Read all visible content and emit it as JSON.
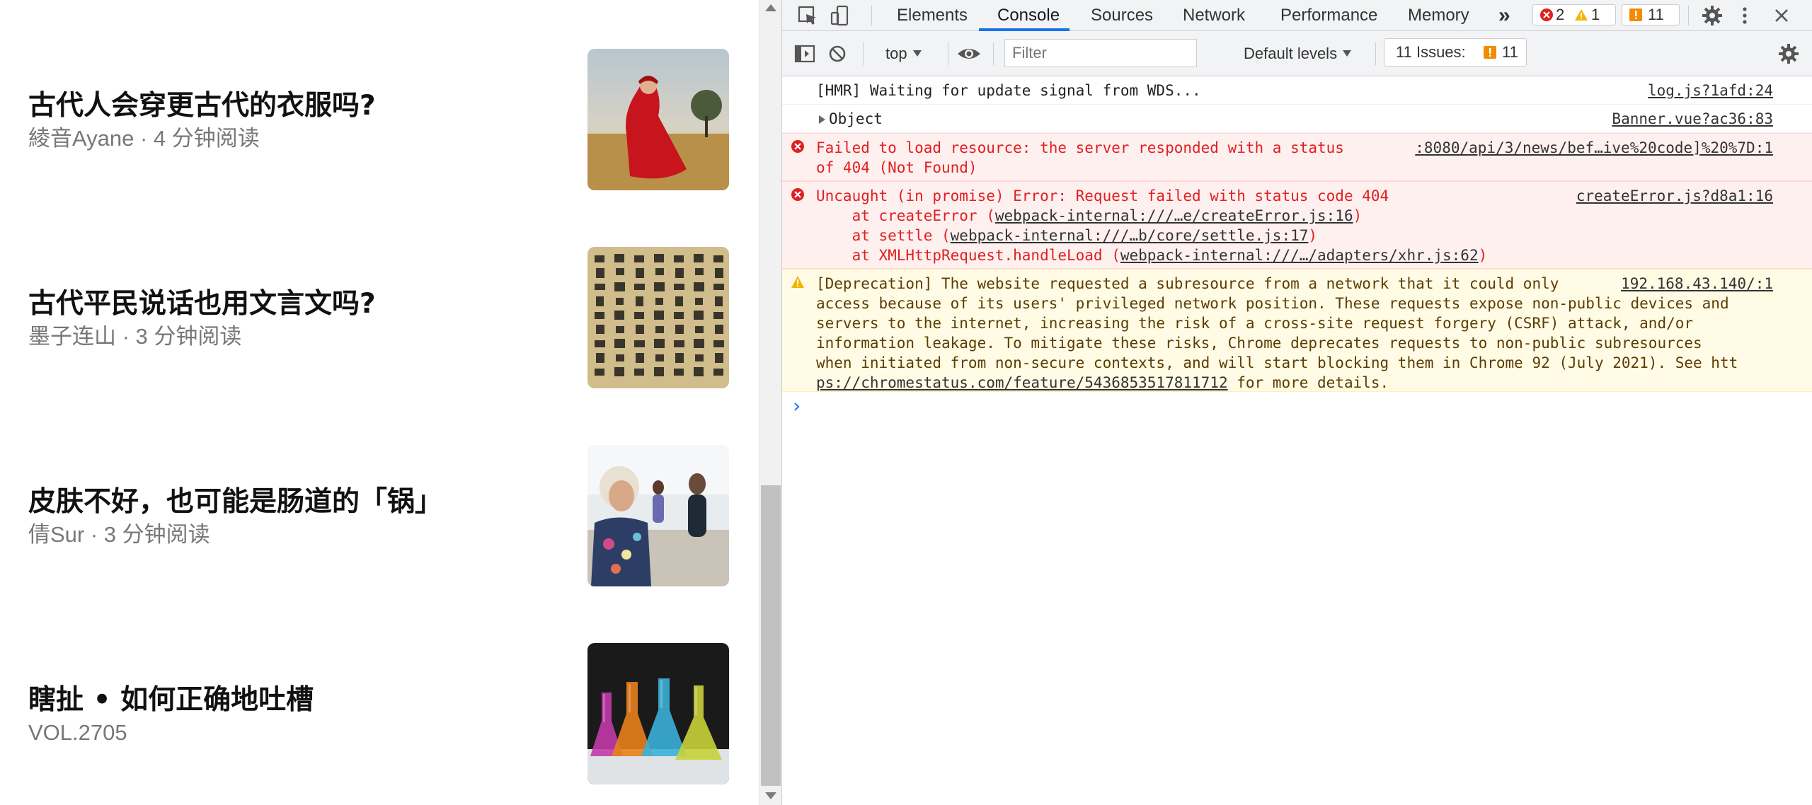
{
  "articles": [
    {
      "title": "古代人会穿更古代的衣服吗?",
      "meta": "綾音Ayane · 4 分钟阅读",
      "thumb": "woman-in-red-dress-photo"
    },
    {
      "title": "古代平民说话也用文言文吗?",
      "meta": "墨子连山 · 3 分钟阅读",
      "thumb": "ancient-chinese-script-photo"
    },
    {
      "title": "皮肤不好，也可能是肠道的「锅」",
      "meta": "倩Sur · 3 分钟阅读",
      "thumb": "yoga-class-photo"
    },
    {
      "title": "瞎扯 • 如何正确地吐槽",
      "meta": "VOL.2705",
      "thumb": "colorful-flasks-photo"
    }
  ],
  "devtools": {
    "tabs": [
      "Elements",
      "Console",
      "Sources",
      "Network",
      "Performance",
      "Memory"
    ],
    "active_tab": "Console",
    "more_tabs": "»",
    "error_count": "2",
    "warning_count": "1",
    "issues_count": "11",
    "toolbar": {
      "context": "top",
      "filter_placeholder": "Filter",
      "levels": "Default levels",
      "issues_label": "11 Issues:",
      "issues_count": "11"
    },
    "messages": [
      {
        "level": "info",
        "text": "[HMR] Waiting for update signal from WDS...",
        "source": "log.js?1afd:24"
      },
      {
        "level": "info",
        "text": "Object",
        "source": "Banner.vue?ac36:83"
      },
      {
        "level": "error",
        "line1": "Failed to load resource: the server responded with a status",
        "line2": "of 404 (Not Found)",
        "source": ":8080/api/3/news/bef…ive%20code]%20%7D:1"
      },
      {
        "level": "error",
        "line1": "Uncaught (in promise) Error: Request failed with status code 404",
        "source": "createError.js?d8a1:16",
        "stack": [
          {
            "prefix": "    at createError (",
            "link": "webpack-internal:///…e/createError.js:16",
            "suffix": ")"
          },
          {
            "prefix": "    at settle (",
            "link": "webpack-internal:///…b/core/settle.js:17",
            "suffix": ")"
          },
          {
            "prefix": "    at XMLHttpRequest.handleLoad (",
            "link": "webpack-internal:///…/adapters/xhr.js:62",
            "suffix": ")"
          }
        ]
      },
      {
        "level": "warning",
        "lines": [
          "[Deprecation] The website requested a subresource from a network that it could only",
          "access because of its users' privileged network position. These requests expose non-public devices and",
          "servers to the internet, increasing the risk of a cross-site request forgery (CSRF) attack, and/or",
          "information leakage. To mitigate these risks, Chrome deprecates requests to non-public subresources",
          "when initiated from non-secure contexts, and will start blocking them in Chrome 92 (July 2021). See htt"
        ],
        "link_tail": "ps://chromestatus.com/feature/5436853517811712",
        "tail_suffix": " for more details.",
        "source": "192.168.43.140/:1"
      }
    ],
    "prompt": "›"
  }
}
